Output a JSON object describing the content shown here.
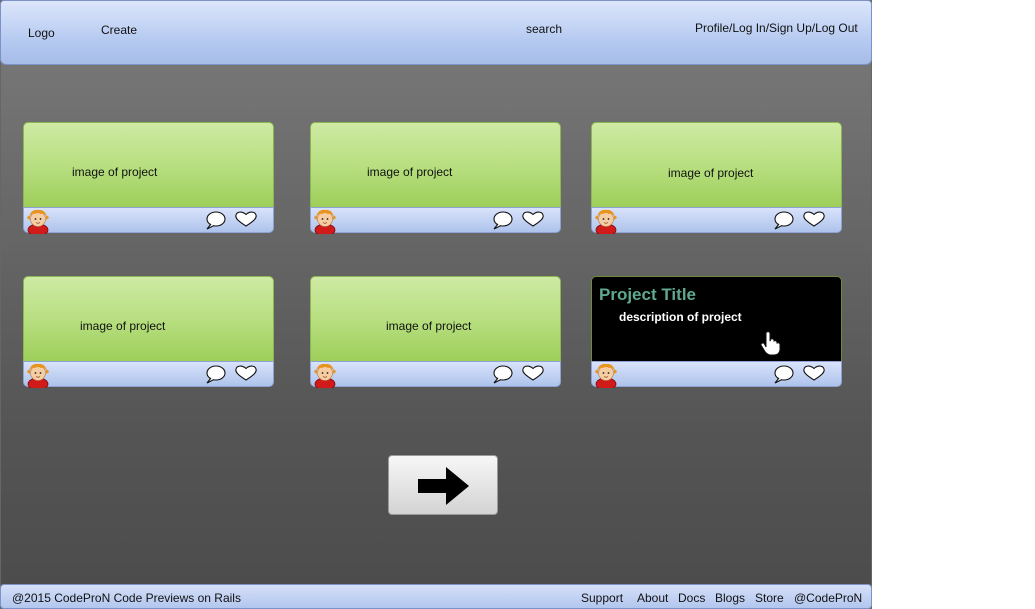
{
  "header": {
    "logo": "Logo",
    "create": "Create",
    "search": "search",
    "account": "Profile/Log In/Sign Up/Log Out"
  },
  "cards": [
    {
      "image_label": "image of project"
    },
    {
      "image_label": "image of project"
    },
    {
      "image_label": "image of project"
    },
    {
      "image_label": "image of project"
    },
    {
      "image_label": "image of project"
    },
    {
      "title": "Project Title",
      "description": "description of project"
    }
  ],
  "footer": {
    "copyright": "@2015 CodeProN Code Previews on Rails",
    "links": [
      "Support",
      "About",
      "Docs",
      "Blogs",
      "Store",
      "@CodeProN"
    ]
  },
  "icons": {
    "avatar": "avatar-icon",
    "comment": "speech-bubble-icon",
    "like": "heart-icon",
    "pointer": "hand-pointer-icon",
    "next": "right-arrow-icon"
  },
  "colors": {
    "header": "#b7cbf1",
    "card_image": "#b4dd7b",
    "project_title": "#5fa891",
    "background": "#666666"
  }
}
